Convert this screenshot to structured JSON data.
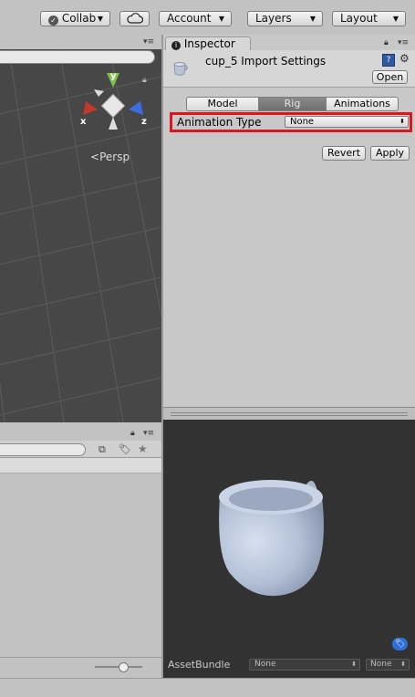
{
  "toolbar": {
    "collab_label": "Collab",
    "account_label": "Account",
    "layers_label": "Layers",
    "layout_label": "Layout"
  },
  "scene": {
    "gizmo": {
      "y": "y",
      "x": "x",
      "z": "z"
    },
    "persp_label": "Persp"
  },
  "inspector": {
    "tab_label": "Inspector",
    "title": "cup_5 Import Settings",
    "open_label": "Open",
    "tabs": [
      {
        "label": "Model",
        "active": false
      },
      {
        "label": "Rig",
        "active": true
      },
      {
        "label": "Animations",
        "active": false
      }
    ],
    "animation_type_label": "Animation Type",
    "animation_type_value": "None",
    "revert_label": "Revert",
    "apply_label": "Apply"
  },
  "preview": {
    "assetbundle_label": "AssetBundle",
    "assetbundle_value": "None",
    "variant_value": "None"
  },
  "colors": {
    "highlight": "#e0141e",
    "scene_bg": "#474747",
    "preview_bg": "#323232",
    "cup": "#b7c3d8"
  }
}
